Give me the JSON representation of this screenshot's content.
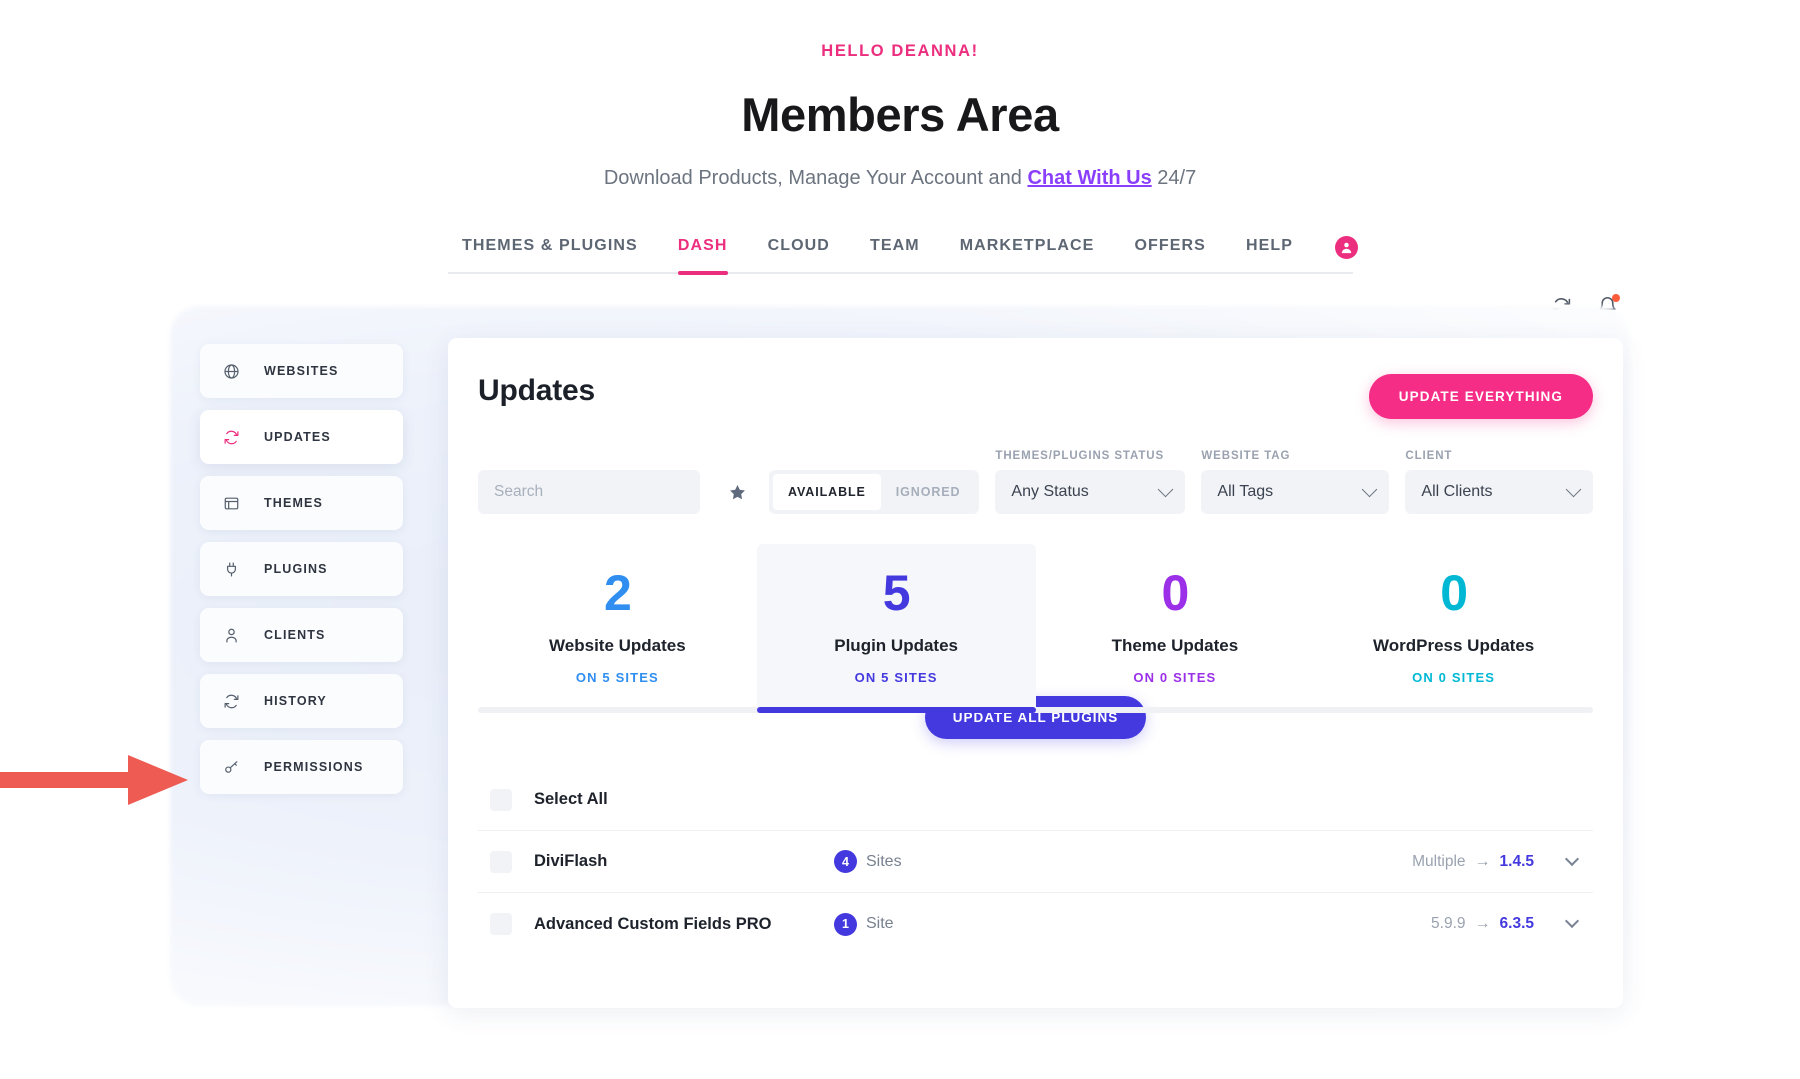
{
  "header": {
    "greeting": "HELLO DEANNA!",
    "title": "Members Area",
    "subtitle_pre": "Download Products, Manage Your Account and ",
    "subtitle_link": "Chat With Us",
    "subtitle_post": " 24/7"
  },
  "nav": {
    "items": [
      {
        "label": "THEMES & PLUGINS",
        "active": false
      },
      {
        "label": "DASH",
        "active": true
      },
      {
        "label": "CLOUD",
        "active": false
      },
      {
        "label": "TEAM",
        "active": false
      },
      {
        "label": "MARKETPLACE",
        "active": false
      },
      {
        "label": "OFFERS",
        "active": false
      },
      {
        "label": "HELP",
        "active": false
      }
    ],
    "avatar_icon": "user-circle-icon",
    "active_color": "#ec2e7e"
  },
  "utility": {
    "refresh_icon": "refresh-icon",
    "notifications_icon": "bell-icon",
    "notification_dot_color": "#ff5c3c"
  },
  "sidebar": {
    "items": [
      {
        "label": "WEBSITES",
        "icon": "globe-icon",
        "active": false
      },
      {
        "label": "UPDATES",
        "icon": "refresh-icon",
        "active": true
      },
      {
        "label": "THEMES",
        "icon": "window-icon",
        "active": false
      },
      {
        "label": "PLUGINS",
        "icon": "plug-icon",
        "active": false
      },
      {
        "label": "CLIENTS",
        "icon": "person-icon",
        "active": false
      },
      {
        "label": "HISTORY",
        "icon": "refresh-icon",
        "active": false
      },
      {
        "label": "PERMISSIONS",
        "icon": "key-icon",
        "active": false
      }
    ]
  },
  "annotation": {
    "arrow_icon": "right-arrow-annotation",
    "color": "#ee5b52",
    "points_to": "sidebar-item-updates"
  },
  "main": {
    "title": "Updates",
    "update_everything_label": "UPDATE EVERYTHING",
    "update_everything_color": "#f52d86"
  },
  "filters": {
    "search": {
      "placeholder": "Search",
      "value": ""
    },
    "favorite_icon": "star-icon",
    "toggle": {
      "options": [
        "AVAILABLE",
        "IGNORED"
      ],
      "selected": "AVAILABLE"
    },
    "selects": [
      {
        "label": "THEMES/PLUGINS STATUS",
        "value": "Any Status",
        "name": "status-select"
      },
      {
        "label": "WEBSITE TAG",
        "value": "All Tags",
        "name": "tag-select"
      },
      {
        "label": "CLIENT",
        "value": "All Clients",
        "name": "client-select"
      }
    ]
  },
  "stats": {
    "cards": [
      {
        "count": "2",
        "name": "Website Updates",
        "sites": "ON 5 SITES",
        "color": "#2f8ef0",
        "active": false
      },
      {
        "count": "5",
        "name": "Plugin Updates",
        "sites": "ON 5 SITES",
        "color": "#4339df",
        "active": true
      },
      {
        "count": "0",
        "name": "Theme Updates",
        "sites": "ON 0 SITES",
        "color": "#9b30e8",
        "active": false
      },
      {
        "count": "0",
        "name": "WordPress Updates",
        "sites": "ON 0 SITES",
        "color": "#00b8d4",
        "active": false
      }
    ],
    "progress_color": "#4339df",
    "update_all_label": "UPDATE ALL PLUGINS"
  },
  "list": {
    "select_all_label": "Select All",
    "rows": [
      {
        "name": "DiviFlash",
        "site_count": "4",
        "site_word": "Sites",
        "version_from": "Multiple",
        "version_to": "1.4.5"
      },
      {
        "name": "Advanced Custom Fields PRO",
        "site_count": "1",
        "site_word": "Site",
        "version_from": "5.9.9",
        "version_to": "6.3.5"
      }
    ],
    "arrow_glyph": "→"
  }
}
